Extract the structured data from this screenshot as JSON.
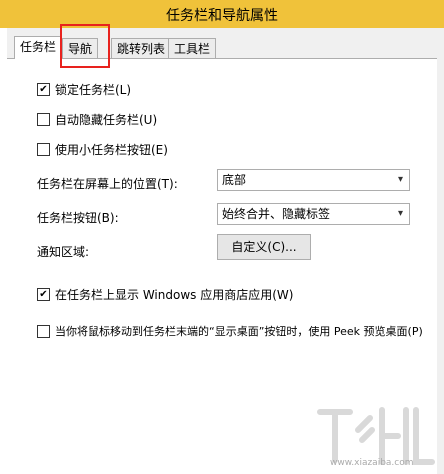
{
  "window": {
    "title": "任务栏和导航属性"
  },
  "tabs": [
    {
      "label": "任务栏",
      "active": true
    },
    {
      "label": "导航",
      "active": false
    },
    {
      "label": "跳转列表",
      "active": false
    },
    {
      "label": "工具栏",
      "active": false
    }
  ],
  "taskbar": {
    "lock": {
      "label": "锁定任务栏(L)",
      "checked": true
    },
    "autohide": {
      "label": "自动隐藏任务栏(U)",
      "checked": false
    },
    "small_buttons": {
      "label": "使用小任务栏按钮(E)",
      "checked": false
    },
    "location": {
      "label": "任务栏在屏幕上的位置(T):",
      "value": "底部"
    },
    "buttons": {
      "label": "任务栏按钮(B):",
      "value": "始终合并、隐藏标签"
    },
    "notification": {
      "label": "通知区域:",
      "button": "自定义(C)..."
    },
    "store_apps": {
      "label": "在任务栏上显示 Windows 应用商店应用(W)",
      "checked": true
    },
    "peek": {
      "label": "当你将鼠标移动到任务栏末端的“显示桌面”按钮时，使用 Peek 预览桌面(P)",
      "checked": false
    }
  },
  "colors": {
    "titlebar": "#f0c23a",
    "highlight": "#e8221e"
  },
  "watermark": {
    "url": "www.xiazaiba.com"
  }
}
